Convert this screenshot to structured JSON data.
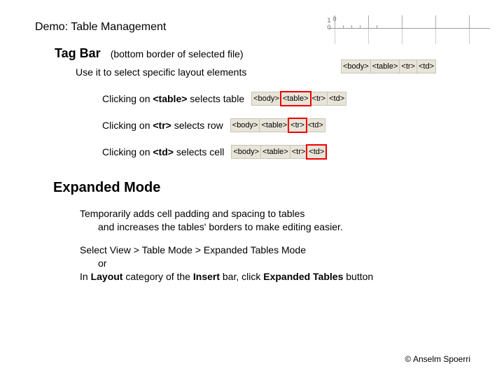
{
  "slide": {
    "demo_title": "Demo: Table Management",
    "tagbar": {
      "title": "Tag Bar",
      "paren": "(bottom border of selected file)",
      "tags": [
        "<body>",
        "<table>",
        "<tr>",
        "<td>"
      ]
    },
    "use_line": "Use it to select specific layout elements",
    "click_rows": [
      {
        "prefix": "Clicking on ",
        "bold": "<table>",
        "suffix": " selects table",
        "tags": [
          "<body>",
          "<table>",
          "<tr>",
          "<td>"
        ],
        "hl_index": 1
      },
      {
        "prefix": "Clicking on ",
        "bold": "<tr>",
        "suffix": " selects row",
        "tags": [
          "<body>",
          "<table>",
          "<tr>",
          "<td>"
        ],
        "hl_index": 2
      },
      {
        "prefix": "Clicking on ",
        "bold": "<td>",
        "suffix": " selects cell",
        "tags": [
          "<body>",
          "<table>",
          "<tr>",
          "<td>"
        ],
        "hl_index": 3
      }
    ],
    "expanded": {
      "title": "Expanded Mode",
      "desc1a": "Temporarily adds cell padding and spacing to tables",
      "desc1b": "and increases the tables' borders to make editing easier.",
      "sel1a": "Select View > Table Mode > Expanded Tables Mode",
      "sel1b": "or",
      "sel2a": "In ",
      "sel2_bold1": "Layout",
      "sel2b": " category of the ",
      "sel2_bold2": "Insert",
      "sel2c": " bar, click ",
      "sel2_bold3": "Expanded Tables",
      "sel2d": " button"
    },
    "footer": "© Anselm Spoerri",
    "ruler": {
      "n0": "0",
      "n1": "1"
    }
  }
}
